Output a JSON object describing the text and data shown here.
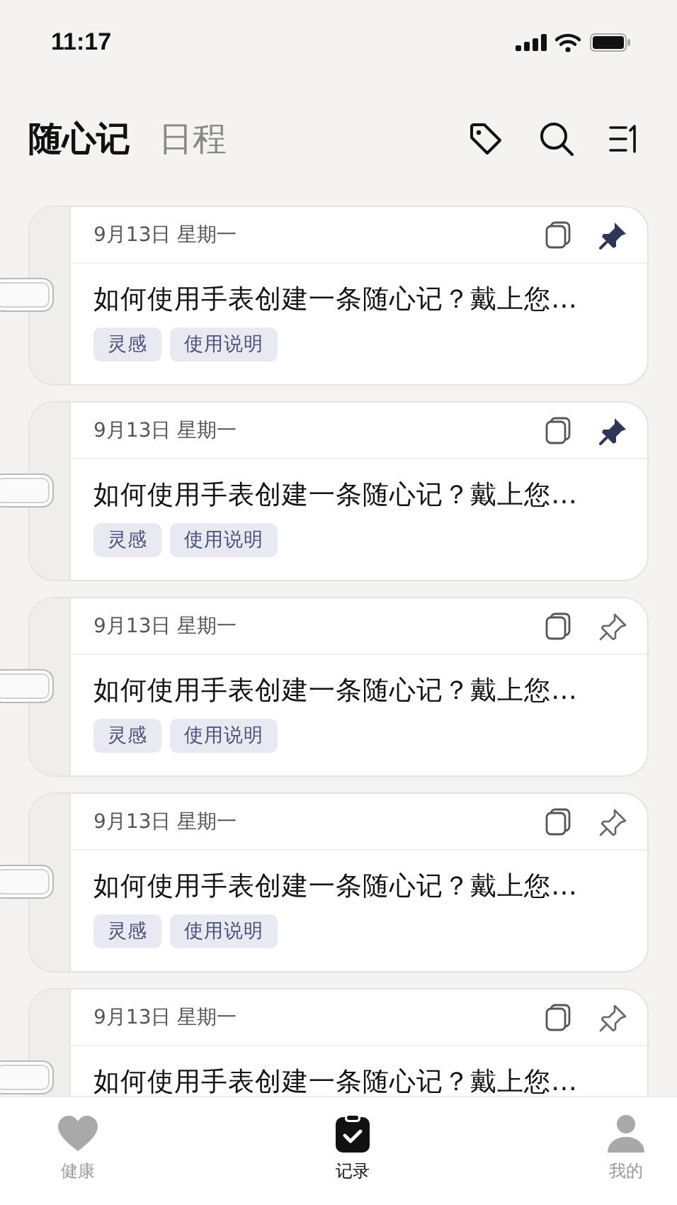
{
  "status_bar": {
    "time": "11:17"
  },
  "header": {
    "tabs": [
      {
        "label": "随心记",
        "selected": true
      },
      {
        "label": "日程",
        "selected": false
      }
    ]
  },
  "cards": [
    {
      "date": "9月13日 星期一",
      "pinned": true,
      "title": "如何使用手表创建一条随心记？戴上您…",
      "tags": [
        "灵感",
        "使用说明"
      ]
    },
    {
      "date": "9月13日 星期一",
      "pinned": true,
      "title": "如何使用手表创建一条随心记？戴上您…",
      "tags": [
        "灵感",
        "使用说明"
      ]
    },
    {
      "date": "9月13日 星期一",
      "pinned": false,
      "title": "如何使用手表创建一条随心记？戴上您…",
      "tags": [
        "灵感",
        "使用说明"
      ]
    },
    {
      "date": "9月13日 星期一",
      "pinned": false,
      "title": "如何使用手表创建一条随心记？戴上您…",
      "tags": [
        "灵感",
        "使用说明"
      ]
    },
    {
      "date": "9月13日 星期一",
      "pinned": false,
      "title": "如何使用手表创建一条随心记？戴上您…"
    }
  ],
  "bottom_nav": [
    {
      "label": "健康",
      "kind": "heart",
      "selected": false
    },
    {
      "label": "记录",
      "kind": "clipboard",
      "selected": true
    },
    {
      "label": "我的",
      "kind": "person",
      "selected": false
    }
  ]
}
